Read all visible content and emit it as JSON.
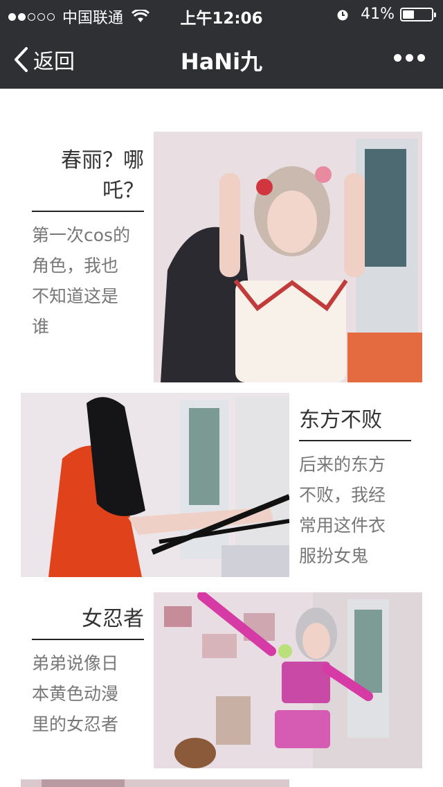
{
  "status_bar": {
    "carrier": "中国联通",
    "time": "上午12:06",
    "battery": "41%",
    "battery_level": 0.41,
    "signal_bars": 2
  },
  "nav": {
    "back_label": "返回",
    "title": "HaNi九"
  },
  "posts": [
    {
      "title": "春丽？哪吒？",
      "title_line1": "春丽？哪",
      "title_line2": "吒？",
      "desc_lines": [
        "第一次cos的",
        "角色，我也",
        "不知道这是",
        "谁"
      ]
    },
    {
      "title": "东方不败",
      "desc_lines": [
        "后来的东方",
        "不败，我经",
        "常用这件衣",
        "服扮女鬼"
      ]
    },
    {
      "title": "女忍者",
      "desc_lines": [
        "弟弟说像日",
        "本黄色动漫",
        "里的女忍者"
      ]
    }
  ],
  "colors": {
    "header_bg": "#2f3033",
    "text": "#333333",
    "desc": "#777777"
  }
}
